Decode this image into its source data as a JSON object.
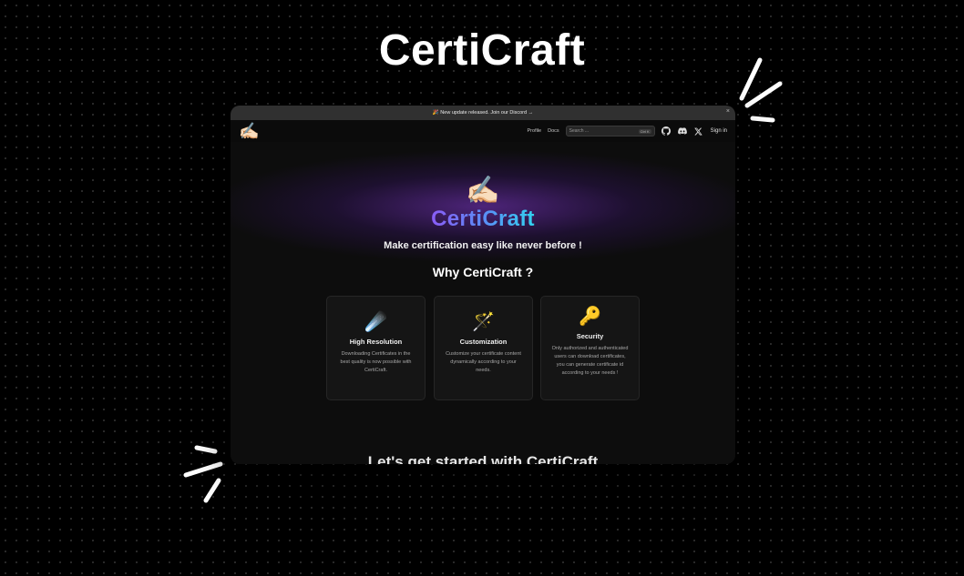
{
  "hero": {
    "title": "CertiCraft"
  },
  "banner": {
    "text": "🎉 New update released. Join our Discord →",
    "close_icon": "×"
  },
  "nav": {
    "logo_emoji": "✍🏻",
    "links": [
      "Profile",
      "Docs"
    ],
    "search_placeholder": "Search ...",
    "search_shortcut": "Ctrl K",
    "icons": [
      "github-icon",
      "discord-icon",
      "x-icon"
    ],
    "sign_in": "Sign in"
  },
  "main": {
    "brand_emoji": "✍🏻",
    "brand_name": "CertiCraft",
    "tagline": "Make certification easy like never before !",
    "why_title": "Why CertiCraft ?",
    "features": [
      {
        "emoji": "☄️",
        "title": "High Resolution",
        "desc": "Downloading Certificates in the best quality is now possible with CertiCraft."
      },
      {
        "emoji": "🪄",
        "title": "Customization",
        "desc": "Customize your certificate content dynamically according to your needs."
      },
      {
        "emoji": "🔑",
        "title": "Security",
        "desc": "Only authorized and authenticated users can download certificates, you can generate certificate id according to your needs !"
      }
    ],
    "cta_heading": "Let's get started with CertiCraft"
  },
  "colors": {
    "background": "#000000",
    "window": "#0d0d0d",
    "accent_gradient": [
      "#8a5cf6",
      "#5b8df7",
      "#32d3f0"
    ],
    "glow": "#58288c"
  }
}
